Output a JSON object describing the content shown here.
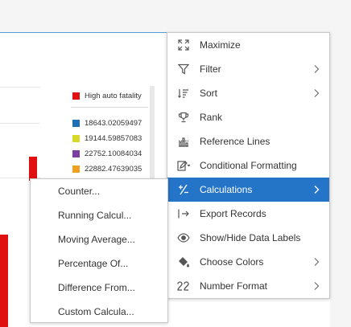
{
  "legend": {
    "title": "High auto fatality",
    "items": [
      {
        "label": "18643.02059497",
        "color": "#1f6fb4"
      },
      {
        "label": "19144.59857083",
        "color": "#d8d82a"
      },
      {
        "label": "22752.10084034",
        "color": "#7a3fa0"
      },
      {
        "label": "22882.47639035",
        "color": "#f0a020"
      }
    ],
    "title_color": "#e01010"
  },
  "menu": {
    "items": [
      {
        "label": "Maximize",
        "icon": "maximize-icon"
      },
      {
        "label": "Filter",
        "icon": "filter-icon"
      },
      {
        "label": "Sort",
        "icon": "sort-icon"
      },
      {
        "label": "Rank",
        "icon": "trophy-icon"
      },
      {
        "label": "Reference Lines",
        "icon": "reference-lines-icon"
      },
      {
        "label": "Conditional Formatting",
        "icon": "conditional-formatting-icon"
      },
      {
        "label": "Calculations",
        "icon": "calculations-icon"
      },
      {
        "label": "Export Records",
        "icon": "export-icon"
      },
      {
        "label": "Show/Hide Data Labels",
        "icon": "eye-icon"
      },
      {
        "label": "Choose Colors",
        "icon": "paint-bucket-icon"
      },
      {
        "label": "Number Format",
        "icon": "number-format-icon"
      }
    ],
    "selected": "Calculations",
    "accent": "#2474c8"
  },
  "submenu": {
    "items": [
      "Counter...",
      "Running Calcul...",
      "Moving Average...",
      "Percentage Of...",
      "Difference From...",
      "Custom Calcula..."
    ]
  }
}
